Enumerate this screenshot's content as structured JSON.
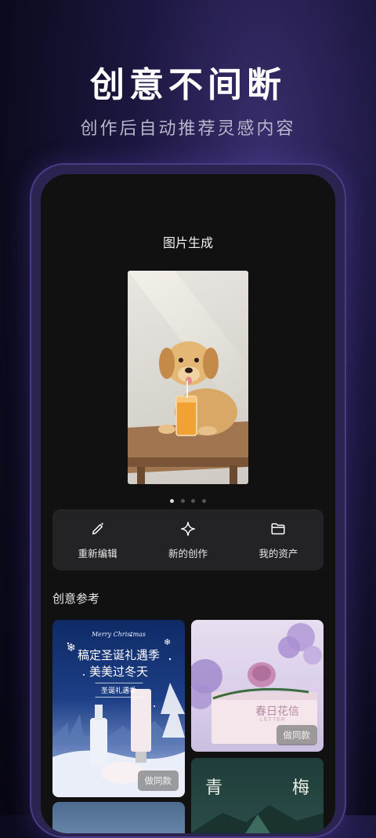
{
  "hero": {
    "title": "创意不间断",
    "subtitle": "创作后自动推荐灵感内容"
  },
  "screen": {
    "title": "图片生成",
    "carousel": {
      "count": 4,
      "active_index": 0
    },
    "actions": [
      {
        "label": "重新编辑",
        "icon": "pen-sparkle-icon"
      },
      {
        "label": "新的创作",
        "icon": "sparkle-icon"
      },
      {
        "label": "我的资产",
        "icon": "folder-icon"
      }
    ],
    "section_title": "创意参考",
    "cards": {
      "xmas": {
        "en": "Merry Christmas",
        "line1": "稿定圣诞礼遇季",
        "line2": "美美过冬天",
        "tag": "圣诞礼遇季",
        "button": "做同款"
      },
      "flower": {
        "title": "春日花信",
        "sub": "LETTER",
        "button": "做同款"
      },
      "green": {
        "left": "青",
        "right": "梅"
      }
    }
  },
  "colors": {
    "background": "#0c0b1e",
    "screen": "#111112",
    "action_bar": "#232325"
  }
}
